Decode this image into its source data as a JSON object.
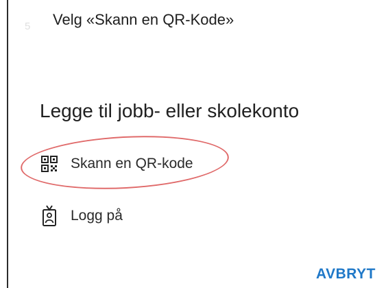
{
  "instruction": {
    "step_number": "5",
    "text": "Velg «Skann en QR-Kode»"
  },
  "dialog": {
    "title": "Legge til jobb- eller skolekonto",
    "options": [
      {
        "label": "Skann en QR-kode",
        "icon": "qr-code-icon"
      },
      {
        "label": "Logg på",
        "icon": "id-badge-icon"
      }
    ],
    "cancel_label": "AVBRYT"
  },
  "colors": {
    "highlight": "#e06a6a",
    "accent": "#1f78c8"
  }
}
